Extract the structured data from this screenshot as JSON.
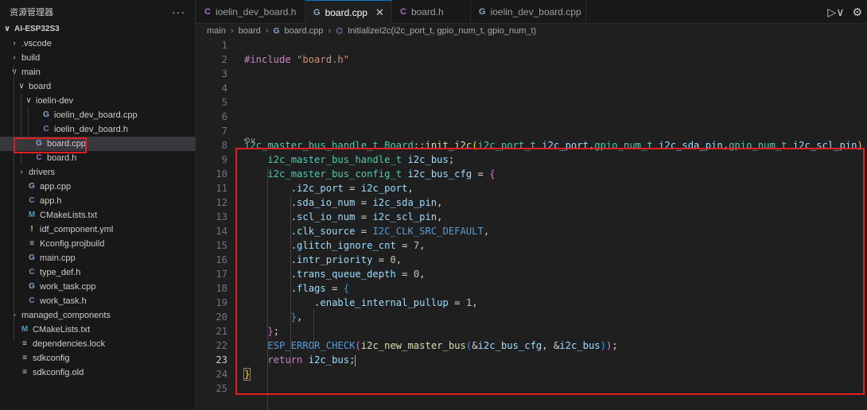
{
  "sidebar": {
    "title": "资源管理器",
    "more": "···",
    "tree": [
      {
        "label": "AI-ESP32S3",
        "chev": "∨",
        "icon": "",
        "icls": "",
        "depth": 0,
        "root": true
      },
      {
        "label": ".vscode",
        "chev": "›",
        "icon": "",
        "icls": "",
        "depth": 1
      },
      {
        "label": "build",
        "chev": "›",
        "icon": "",
        "icls": "",
        "depth": 1
      },
      {
        "label": "main",
        "chev": "∨",
        "icon": "",
        "icls": "",
        "depth": 1
      },
      {
        "label": "board",
        "chev": "∨",
        "icon": "",
        "icls": "",
        "depth": 2
      },
      {
        "label": "ioelin-dev",
        "chev": "∨",
        "icon": "",
        "icls": "",
        "depth": 3
      },
      {
        "label": "ioelin_dev_board.cpp",
        "chev": "",
        "icon": "G",
        "icls": "ic-cpp",
        "depth": 4
      },
      {
        "label": "ioelin_dev_board.h",
        "chev": "",
        "icon": "C",
        "icls": "ic-h",
        "depth": 4
      },
      {
        "label": "board.cpp",
        "chev": "",
        "icon": "G",
        "icls": "ic-cpp",
        "depth": 3,
        "active": true
      },
      {
        "label": "board.h",
        "chev": "",
        "icon": "C",
        "icls": "ic-h",
        "depth": 3
      },
      {
        "label": "drivers",
        "chev": "›",
        "icon": "",
        "icls": "",
        "depth": 2
      },
      {
        "label": "app.cpp",
        "chev": "",
        "icon": "G",
        "icls": "ic-cpp",
        "depth": 2
      },
      {
        "label": "app.h",
        "chev": "",
        "icon": "C",
        "icls": "ic-h",
        "depth": 2
      },
      {
        "label": "CMakeLists.txt",
        "chev": "",
        "icon": "M",
        "icls": "ic-m",
        "depth": 2
      },
      {
        "label": "idf_component.yml",
        "chev": "",
        "icon": "!",
        "icls": "ic-yml",
        "depth": 2
      },
      {
        "label": "Kconfig.projbuild",
        "chev": "",
        "icon": "≡",
        "icls": "ic-list",
        "depth": 2
      },
      {
        "label": "main.cpp",
        "chev": "",
        "icon": "G",
        "icls": "ic-cpp",
        "depth": 2
      },
      {
        "label": "type_def.h",
        "chev": "",
        "icon": "C",
        "icls": "ic-h",
        "depth": 2
      },
      {
        "label": "work_task.cpp",
        "chev": "",
        "icon": "G",
        "icls": "ic-cpp",
        "depth": 2
      },
      {
        "label": "work_task.h",
        "chev": "",
        "icon": "C",
        "icls": "ic-h",
        "depth": 2
      },
      {
        "label": "managed_components",
        "chev": "›",
        "icon": "",
        "icls": "",
        "depth": 1
      },
      {
        "label": "CMakeLists.txt",
        "chev": "",
        "icon": "M",
        "icls": "ic-m",
        "depth": 1
      },
      {
        "label": "dependencies.lock",
        "chev": "",
        "icon": "≡",
        "icls": "ic-list",
        "depth": 1
      },
      {
        "label": "sdkconfig",
        "chev": "",
        "icon": "≡",
        "icls": "ic-list",
        "depth": 1
      },
      {
        "label": "sdkconfig.old",
        "chev": "",
        "icon": "≡",
        "icls": "ic-list",
        "depth": 1
      }
    ]
  },
  "tabs": [
    {
      "label": "ioelin_dev_board.h",
      "icon": "C",
      "icls": "ic-h",
      "active": false,
      "state": ""
    },
    {
      "label": "board.cpp",
      "icon": "G",
      "icls": "ic-cpp",
      "active": true,
      "state": "close"
    },
    {
      "label": "board.h",
      "icon": "C",
      "icls": "ic-h",
      "active": false,
      "state": ""
    },
    {
      "label": "ioelin_dev_board.cpp",
      "icon": "G",
      "icls": "ic-cpp",
      "active": false,
      "state": "dirty"
    }
  ],
  "tab_actions": {
    "run": "▷∨",
    "settings": "⚙"
  },
  "breadcrumb": {
    "items": [
      "main",
      "board",
      "board.cpp",
      "InitializeI2c(i2c_port_t, gpio_num_t, gpio_num_t)"
    ],
    "separator": "›",
    "file_icon": "G",
    "func_icon": "⌬"
  },
  "editor": {
    "inlay_hint": "⟲∨",
    "current_line": 23,
    "lines": [
      {
        "n": 1,
        "tokens": []
      },
      {
        "n": 2,
        "tokens": [
          [
            "#include ",
            "t-pp"
          ],
          [
            "\"board.h\"",
            "t-str"
          ]
        ]
      },
      {
        "n": 3,
        "tokens": []
      },
      {
        "n": 4,
        "tokens": []
      },
      {
        "n": 5,
        "tokens": []
      },
      {
        "n": 6,
        "tokens": []
      },
      {
        "n": 7,
        "tokens": []
      },
      {
        "n": 8,
        "tokens": [
          [
            "i2c_master_bus_handle_t",
            "t-type"
          ],
          [
            " ",
            "t-plain"
          ],
          [
            "Board",
            "t-type"
          ],
          [
            "::",
            "t-plain"
          ],
          [
            "init_i2c",
            "t-fn"
          ],
          [
            "(",
            "t-br"
          ],
          [
            "i2c_port_t",
            "t-type"
          ],
          [
            " ",
            "t-plain"
          ],
          [
            "i2c_port",
            "t-param"
          ],
          [
            ",",
            "t-plain"
          ],
          [
            "gpio_num_t",
            "t-type"
          ],
          [
            " ",
            "t-plain"
          ],
          [
            "i2c_sda_pin",
            "t-param"
          ],
          [
            ",",
            "t-plain"
          ],
          [
            "gpio_num_t",
            "t-type"
          ],
          [
            " ",
            "t-plain"
          ],
          [
            "i2c_scl_pin",
            "t-param"
          ],
          [
            ")",
            "t-br"
          ],
          [
            " ",
            "t-plain"
          ],
          [
            "{",
            "t-br bracket-match"
          ]
        ]
      },
      {
        "n": 9,
        "tokens": [
          [
            "    ",
            "t-plain"
          ],
          [
            "i2c_master_bus_handle_t",
            "t-type"
          ],
          [
            " ",
            "t-plain"
          ],
          [
            "i2c_bus",
            "t-param"
          ],
          [
            ";",
            "t-plain"
          ]
        ]
      },
      {
        "n": 10,
        "tokens": [
          [
            "    ",
            "t-plain"
          ],
          [
            "i2c_master_bus_config_t",
            "t-type"
          ],
          [
            " ",
            "t-plain"
          ],
          [
            "i2c_bus_cfg",
            "t-param"
          ],
          [
            " = ",
            "t-plain"
          ],
          [
            "{",
            "t-br2"
          ]
        ]
      },
      {
        "n": 11,
        "tokens": [
          [
            "        .",
            "t-plain"
          ],
          [
            "i2c_port",
            "t-param"
          ],
          [
            " = ",
            "t-plain"
          ],
          [
            "i2c_port",
            "t-param"
          ],
          [
            ",",
            "t-plain"
          ]
        ]
      },
      {
        "n": 12,
        "tokens": [
          [
            "        .",
            "t-plain"
          ],
          [
            "sda_io_num",
            "t-param"
          ],
          [
            " = ",
            "t-plain"
          ],
          [
            "i2c_sda_pin",
            "t-param"
          ],
          [
            ",",
            "t-plain"
          ]
        ]
      },
      {
        "n": 13,
        "tokens": [
          [
            "        .",
            "t-plain"
          ],
          [
            "scl_io_num",
            "t-param"
          ],
          [
            " = ",
            "t-plain"
          ],
          [
            "i2c_scl_pin",
            "t-param"
          ],
          [
            ",",
            "t-plain"
          ]
        ]
      },
      {
        "n": 14,
        "tokens": [
          [
            "        .",
            "t-plain"
          ],
          [
            "clk_source",
            "t-param"
          ],
          [
            " = ",
            "t-plain"
          ],
          [
            "I2C_CLK_SRC_DEFAULT",
            "t-macro"
          ],
          [
            ",",
            "t-plain"
          ]
        ]
      },
      {
        "n": 15,
        "tokens": [
          [
            "        .",
            "t-plain"
          ],
          [
            "glitch_ignore_cnt",
            "t-param"
          ],
          [
            " = ",
            "t-plain"
          ],
          [
            "7",
            "t-num"
          ],
          [
            ",",
            "t-plain"
          ]
        ]
      },
      {
        "n": 16,
        "tokens": [
          [
            "        .",
            "t-plain"
          ],
          [
            "intr_priority",
            "t-param"
          ],
          [
            " = ",
            "t-plain"
          ],
          [
            "0",
            "t-num"
          ],
          [
            ",",
            "t-plain"
          ]
        ]
      },
      {
        "n": 17,
        "tokens": [
          [
            "        .",
            "t-plain"
          ],
          [
            "trans_queue_depth",
            "t-param"
          ],
          [
            " = ",
            "t-plain"
          ],
          [
            "0",
            "t-num"
          ],
          [
            ",",
            "t-plain"
          ]
        ]
      },
      {
        "n": 18,
        "tokens": [
          [
            "        .",
            "t-plain"
          ],
          [
            "flags",
            "t-param"
          ],
          [
            " = ",
            "t-plain"
          ],
          [
            "{",
            "t-br3"
          ]
        ]
      },
      {
        "n": 19,
        "tokens": [
          [
            "            .",
            "t-plain"
          ],
          [
            "enable_internal_pullup",
            "t-param"
          ],
          [
            " = ",
            "t-plain"
          ],
          [
            "1",
            "t-num"
          ],
          [
            ",",
            "t-plain"
          ]
        ]
      },
      {
        "n": 20,
        "tokens": [
          [
            "        ",
            "t-plain"
          ],
          [
            "}",
            "t-br3"
          ],
          [
            ",",
            "t-plain"
          ]
        ]
      },
      {
        "n": 21,
        "tokens": [
          [
            "    ",
            "t-plain"
          ],
          [
            "}",
            "t-br2"
          ],
          [
            ";",
            "t-plain"
          ]
        ]
      },
      {
        "n": 22,
        "tokens": [
          [
            "    ",
            "t-plain"
          ],
          [
            "ESP_ERROR_CHECK",
            "t-macro"
          ],
          [
            "(",
            "t-br2"
          ],
          [
            "i2c_new_master_bus",
            "t-fn"
          ],
          [
            "(",
            "t-br3"
          ],
          [
            "&",
            "t-plain"
          ],
          [
            "i2c_bus_cfg",
            "t-param"
          ],
          [
            ", ",
            "t-plain"
          ],
          [
            "&",
            "t-plain"
          ],
          [
            "i2c_bus",
            "t-param"
          ],
          [
            ")",
            "t-br3"
          ],
          [
            ")",
            "t-br2"
          ],
          [
            ";",
            "t-plain"
          ]
        ]
      },
      {
        "n": 23,
        "tokens": [
          [
            "    ",
            "t-plain"
          ],
          [
            "return",
            "t-kw"
          ],
          [
            " ",
            "t-plain"
          ],
          [
            "i2c_bus",
            "t-param"
          ],
          [
            ";",
            "t-plain"
          ]
        ]
      },
      {
        "n": 24,
        "tokens": [
          [
            "}",
            "t-br bracket-match"
          ]
        ]
      },
      {
        "n": 25,
        "tokens": []
      }
    ]
  }
}
